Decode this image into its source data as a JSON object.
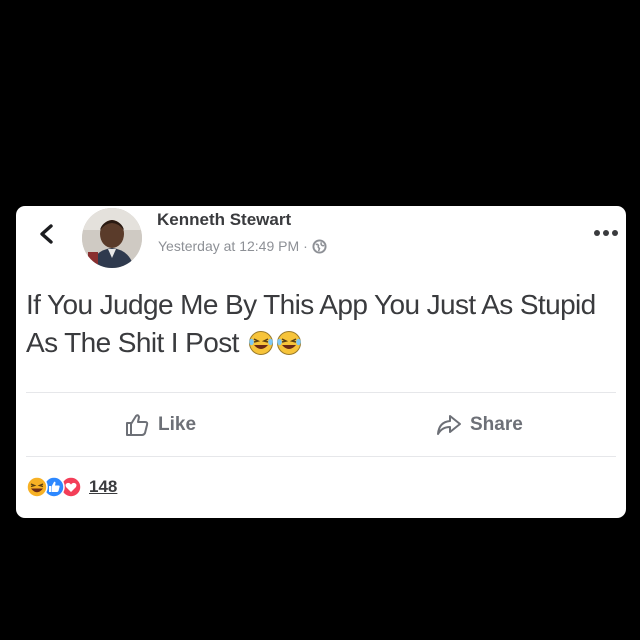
{
  "post": {
    "author_name": "Kenneth Stewart",
    "timestamp": "Yesterday at 12:49 PM",
    "separator": "·",
    "privacy_icon": "globe-icon",
    "text": "If You Judge Me By This App You Just As Stupid As The Shit I Post",
    "text_emojis": [
      "laughing-tears-emoji",
      "laughing-tears-emoji"
    ]
  },
  "actions": {
    "like_label": "Like",
    "like_icon": "thumbs-up-icon",
    "share_label": "Share",
    "share_icon": "share-arrow-icon"
  },
  "reactions": {
    "icons": [
      "haha-reaction-icon",
      "like-reaction-icon",
      "love-reaction-icon"
    ],
    "count": "148"
  },
  "colors": {
    "background": "#000000",
    "card": "#ffffff",
    "text_primary": "#3a3b3e",
    "text_secondary": "#8d9096",
    "like_blue": "#2d88ff",
    "love_red": "#f33e58",
    "haha_yellow": "#f7b125"
  }
}
